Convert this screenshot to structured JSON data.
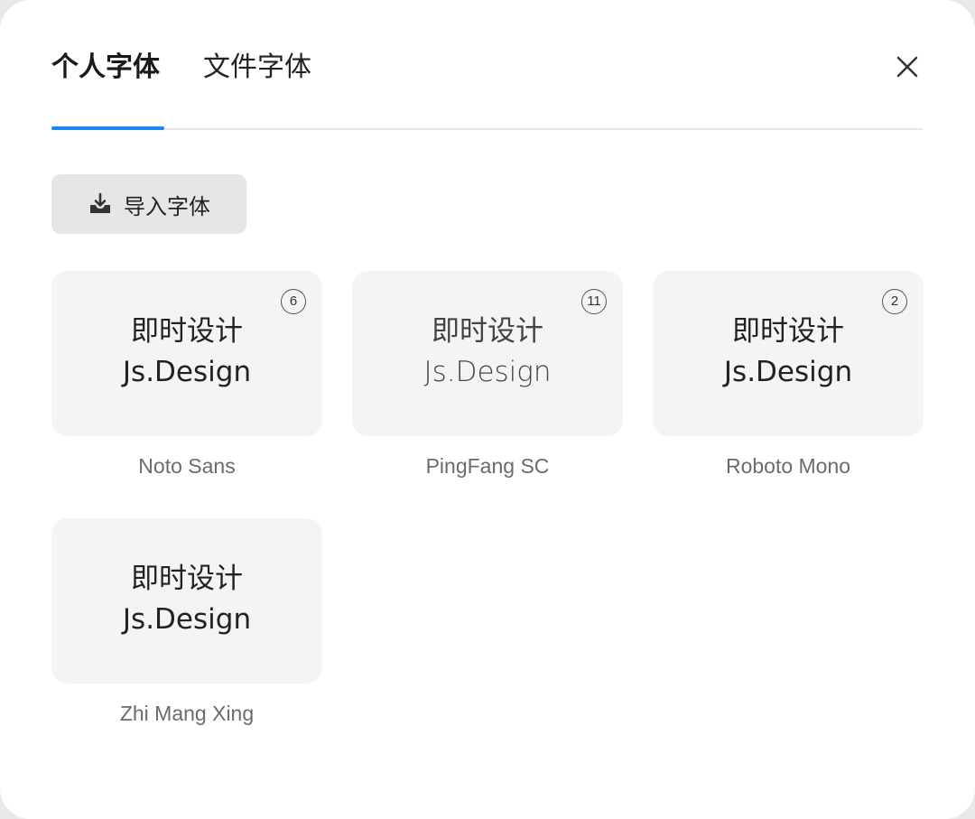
{
  "tabs": [
    {
      "label": "个人字体",
      "active": true
    },
    {
      "label": "文件字体",
      "active": false
    }
  ],
  "icons": {
    "close": "close-icon",
    "import": "download-tray-icon"
  },
  "import_button": {
    "label": "导入字体"
  },
  "accent_color": "#1b86f5",
  "fonts": [
    {
      "name": "Noto Sans",
      "preview_cn": "即时设计",
      "preview_en": "Js.Design",
      "count": "6"
    },
    {
      "name": "PingFang SC",
      "preview_cn": "即时设计",
      "preview_en": "Js.Design",
      "count": "11"
    },
    {
      "name": "Roboto Mono",
      "preview_cn": "即时设计",
      "preview_en": "Js.Design",
      "count": "2"
    },
    {
      "name": "Zhi Mang Xing",
      "preview_cn": "即时设计",
      "preview_en": "Js.Design",
      "count": ""
    }
  ]
}
